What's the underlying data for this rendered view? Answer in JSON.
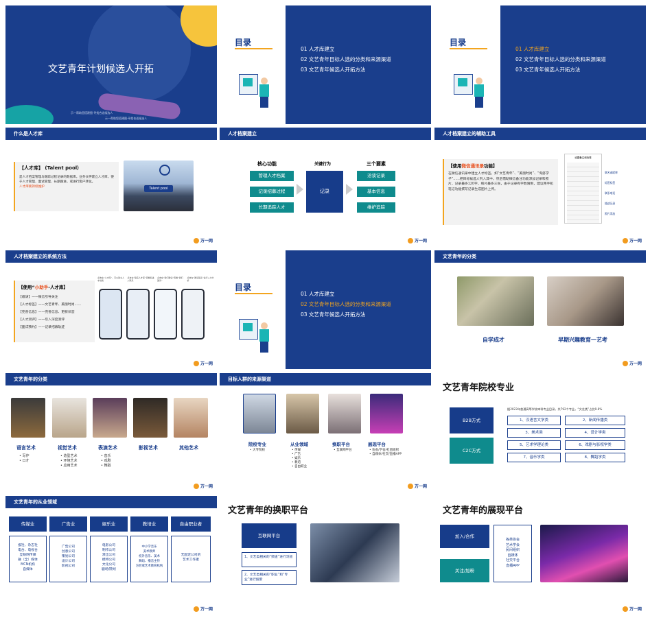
{
  "s1": {
    "title": "文艺青年计划候选人开拓",
    "sub1": "示一帮助您搭建图·寻找合适候选人",
    "sub2": "示一帮助您搭建图·寻找合适候选人"
  },
  "toc": {
    "label": "目录",
    "items": [
      "01 人才库建立",
      "02 文艺青年目标人选的分类和来源渠道",
      "03 文艺青年候选人开拓方法"
    ]
  },
  "s4": {
    "header": "什么是人才库",
    "bracket": "【人才库】 (Talent pool）",
    "body": "是人才档案管理与跟踪过程记录的数据库。业务伙伴建立人才库，便于人才管理、面试管理、长期跟进，或进行客户转化。",
    "highlight": "人才库要持续维护",
    "photo_label": "Talent pool"
  },
  "s5": {
    "header": "人才档案建立",
    "col1": "核心功能",
    "col2": "关键行为",
    "col3": "三个要素",
    "core": [
      "管理人才档案",
      "记录招募过程",
      "长期追踪人才"
    ],
    "action": "记录",
    "elements": [
      "洽谈记录",
      "基本信息",
      "维护追踪"
    ]
  },
  "s6": {
    "header": "人才档案建立的辅助工具",
    "title_pre": "【使用",
    "title_hl": "微信通讯录",
    "title_post": "功能】",
    "body": "在微信通讯录中建立人才标签，如“文艺青年”、“美丽时尚”、“淘舒学子”……把目标候选人列入其中，然后借助微信备注功能添加记录和照片，记录最多120字，照片最多三张，由于记录有字数限制，建议用手机笔记功能撰写记录生成图片上传。",
    "phone_title": "设置备注和标签",
    "labels": [
      "联名或昵称",
      "标签标签",
      "联系电话",
      "描述记录",
      "照片添加"
    ]
  },
  "s7": {
    "header": "人才档案建立的系统方法",
    "title_pre": "【使用“",
    "title_hl": "小助手",
    "title_post": "-人才库】",
    "items": [
      "【邀请】——微信引导关注",
      "【人才标签】——文艺青年、美丽时尚……",
      "【完善信息】——完善信息、更新状态",
      "【人才测评】——引入深度测评",
      "【面试预约】——记录招募轨迹"
    ],
    "captions": [
      "点击在“人才库”，可以建立人才档案",
      "点击在“联名人才库”查看和进入联系",
      "点击在“我们邀请”查看“我们邀请”",
      "点击在“邀请联系”进行入力分析"
    ]
  },
  "s9": {
    "header": "文艺青年的分类",
    "cat1": "自学成才",
    "cat2": "早期兴趣教育一艺考"
  },
  "s10": {
    "header": "文艺青年的分类",
    "cats": [
      {
        "name": "语言艺术",
        "items": [
          "写作",
          "口才"
        ]
      },
      {
        "name": "视觉艺术",
        "items": [
          "造型艺术",
          "环境艺术",
          "应用艺术"
        ]
      },
      {
        "name": "表演艺术",
        "items": [
          "音乐",
          "戏剧",
          "舞蹈"
        ]
      },
      {
        "name": "影视艺术",
        "items": []
      },
      {
        "name": "其他艺术",
        "items": []
      }
    ]
  },
  "s11": {
    "header": "目标人群的来源渠道",
    "cats": [
      {
        "name": "院校专业",
        "items": [
          "大专院校"
        ]
      },
      {
        "name": "从业领域",
        "items": [
          "传媒",
          "广告",
          "娱乐",
          "教培",
          "自由职业"
        ]
      },
      {
        "name": "换职平台",
        "items": [
          "互联网平台"
        ]
      },
      {
        "name": "展现平台",
        "items": [
          "协会/学会/社团组织",
          "自媒体/社交/直播APP"
        ]
      }
    ]
  },
  "s12": {
    "title": "文艺青年院校专业",
    "b2b": "B2B方式",
    "c2c": "C2C方式",
    "note": "据2023年普通高等学校本科专业目录，共792个专业，“文艺类”占比9.6%",
    "majors": [
      "1、汉语言文学类",
      "2、新闻传播类",
      "3、美术类",
      "4、设计学类",
      "5、艺术学理论类",
      "6、戏剧与影视学类",
      "7、音乐学类",
      "8、舞蹈学类"
    ]
  },
  "s13": {
    "header": "文艺青年的从业领域",
    "cols": [
      {
        "name": "传媒业",
        "items": [
          "报社、杂志社",
          "电台、电视台",
          "互联网传媒",
          "融（全）媒体",
          "MCN机构",
          "自媒体"
        ]
      },
      {
        "name": "广告业",
        "items": [
          "广告公司",
          "创意公司",
          "策划公司",
          "设计公司",
          "影视公司"
        ]
      },
      {
        "name": "娱乐业",
        "items": [
          "电影公司",
          "制作公司",
          "演出公司",
          "模特公司",
          "文化公司",
          "剧场/院线"
        ]
      },
      {
        "name": "教培业",
        "items": [
          "中小学音乐",
          "美术教师",
          "校外音乐、美术",
          "舞蹈、播音主持",
          "方腔或艺术教育机构"
        ]
      },
      {
        "name": "自由职业者",
        "items": [
          "无固定公司的",
          "艺术工作者"
        ]
      }
    ]
  },
  "s14": {
    "title": "文艺青年的换职平台",
    "platform": "互联网平台",
    "tip1": "1、文艺类相关的“频道”进行浏览",
    "tip2": "2、文艺类相关的“职业”和“专业”进行搜索"
  },
  "s15": {
    "title": "文艺青年的展现平台",
    "join": "加入/合作",
    "follow": "关注/加粉",
    "list": [
      "各类协会",
      "艺术学会",
      "民间组织",
      "自媒体",
      "社交平台",
      "直播APP"
    ]
  },
  "brand": "万一网",
  "colors": {
    "navy": "#1a3e8c",
    "teal": "#0f8b8d",
    "orange": "#f3a51f"
  }
}
